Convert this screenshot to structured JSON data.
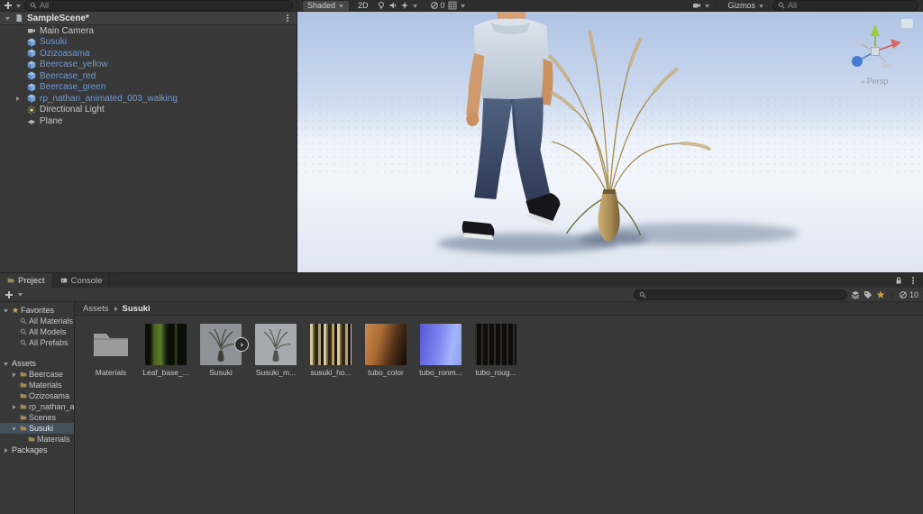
{
  "colors": {
    "prefab_text": "#6c9bd8",
    "selection": "#44505c",
    "accent_blue": "#477ad2"
  },
  "top_toolbar": {
    "hierarchy_search_placeholder": "All",
    "shaded_label": "Shaded",
    "mode_2d_label": "2D",
    "hidden_objects_count": "0",
    "gizmos_label": "Gizmos",
    "scene_search_placeholder": "All"
  },
  "hierarchy": {
    "scene_name": "SampleScene*",
    "items": [
      {
        "label": "Main Camera",
        "kind": "camera"
      },
      {
        "label": "Susuki",
        "kind": "prefab"
      },
      {
        "label": "Ozizoasama",
        "kind": "prefab"
      },
      {
        "label": "Beercase_yellow",
        "kind": "prefab"
      },
      {
        "label": "Beercase_red",
        "kind": "prefab"
      },
      {
        "label": "Beercase_green",
        "kind": "prefab"
      },
      {
        "label": "rp_nathan_animated_003_walking",
        "kind": "prefab",
        "expandable": true
      },
      {
        "label": "Directional Light",
        "kind": "light"
      },
      {
        "label": "Plane",
        "kind": "plane"
      }
    ]
  },
  "scene_view": {
    "persp_label": "Persp"
  },
  "project_panel": {
    "tabs": [
      {
        "label": "Project",
        "icon": "folder",
        "active": true
      },
      {
        "label": "Console",
        "icon": "console",
        "active": false
      }
    ],
    "search_placeholder": "",
    "hidden_count": "10",
    "breadcrumb": {
      "root": "Assets",
      "current": "Susuki"
    },
    "tree_rows": [
      {
        "label": "Favorites",
        "depth": 0,
        "icon": "star",
        "caret": "down",
        "bold": true
      },
      {
        "label": "All Materials",
        "depth": 1,
        "icon": "search"
      },
      {
        "label": "All Models",
        "depth": 1,
        "icon": "search"
      },
      {
        "label": "All Prefabs",
        "depth": 1,
        "icon": "search"
      },
      {
        "label": "Assets",
        "depth": 0,
        "caret": "down",
        "bold": true,
        "gap": true
      },
      {
        "label": "Beercase",
        "depth": 1,
        "icon": "folder",
        "caret": "right"
      },
      {
        "label": "Materials",
        "depth": 1,
        "icon": "folder"
      },
      {
        "label": "Ozizosama",
        "depth": 1,
        "icon": "folder"
      },
      {
        "label": "rp_nathan_a...",
        "depth": 1,
        "icon": "folder",
        "caret": "right"
      },
      {
        "label": "Scenes",
        "depth": 1,
        "icon": "folder"
      },
      {
        "label": "Susuki",
        "depth": 1,
        "icon": "folder",
        "caret": "down",
        "selected": true
      },
      {
        "label": "Materials",
        "depth": 2,
        "icon": "folder"
      },
      {
        "label": "Packages",
        "depth": 0,
        "caret": "right",
        "bold": true
      }
    ],
    "grid_items": [
      {
        "label": "Materials",
        "thumb": "folder"
      },
      {
        "label": "Leaf_base_...",
        "thumb": "leaf"
      },
      {
        "label": "Susuki",
        "thumb": "plant-dark",
        "badge": true
      },
      {
        "label": "Susuki_m...",
        "thumb": "plant-light"
      },
      {
        "label": "susuki_ho...",
        "thumb": "stripes"
      },
      {
        "label": "tubo_color",
        "thumb": "orange"
      },
      {
        "label": "tubo_ronm...",
        "thumb": "normal"
      },
      {
        "label": "tubo_roug...",
        "thumb": "dark"
      }
    ]
  }
}
